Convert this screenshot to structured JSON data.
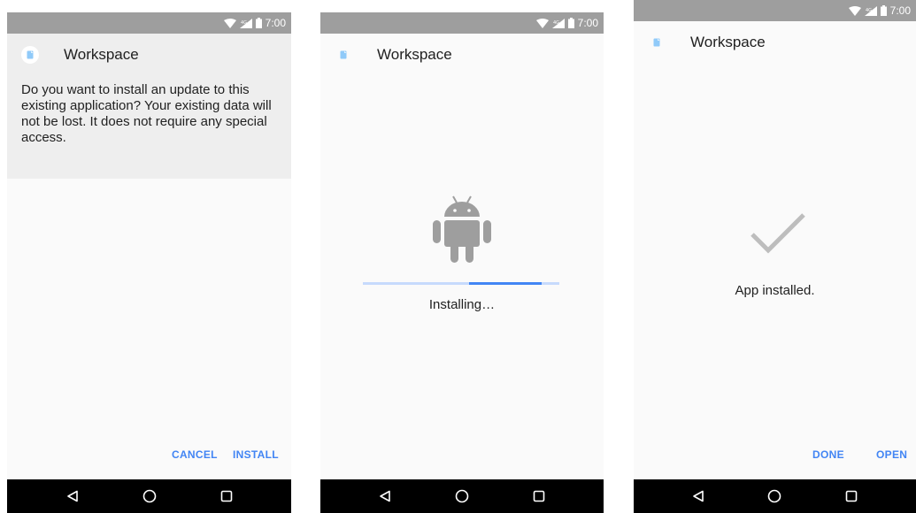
{
  "screens": [
    {
      "status": {
        "time": "7:00"
      },
      "app_name": "Workspace",
      "message": "Do you want to install an update to this existing application? Your existing data will not be lost. It does not require any special access.",
      "buttons": {
        "cancel": "CANCEL",
        "install": "INSTALL"
      }
    },
    {
      "status": {
        "time": "7:00"
      },
      "app_name": "Workspace",
      "progress_text": "Installing…",
      "progress": {
        "start": 0.54,
        "end": 0.91
      }
    },
    {
      "status": {
        "time": "7:00"
      },
      "app_name": "Workspace",
      "result_text": "App installed.",
      "buttons": {
        "done": "DONE",
        "open": "OPEN"
      }
    }
  ],
  "icons": {
    "status": [
      "wifi-icon",
      "signal-icon",
      "battery-icon"
    ],
    "app": "document-app-icon",
    "installing": "android-robot-icon",
    "installed": "checkmark-icon",
    "nav": [
      "back-icon",
      "home-icon",
      "recents-icon"
    ]
  },
  "colors": {
    "accent": "#4285f4",
    "status_bar": "#9e9e9e",
    "header_shade": "#eeeeee",
    "background": "#fafafa",
    "nav_bar": "#000000",
    "robot": "#9e9e9e"
  }
}
